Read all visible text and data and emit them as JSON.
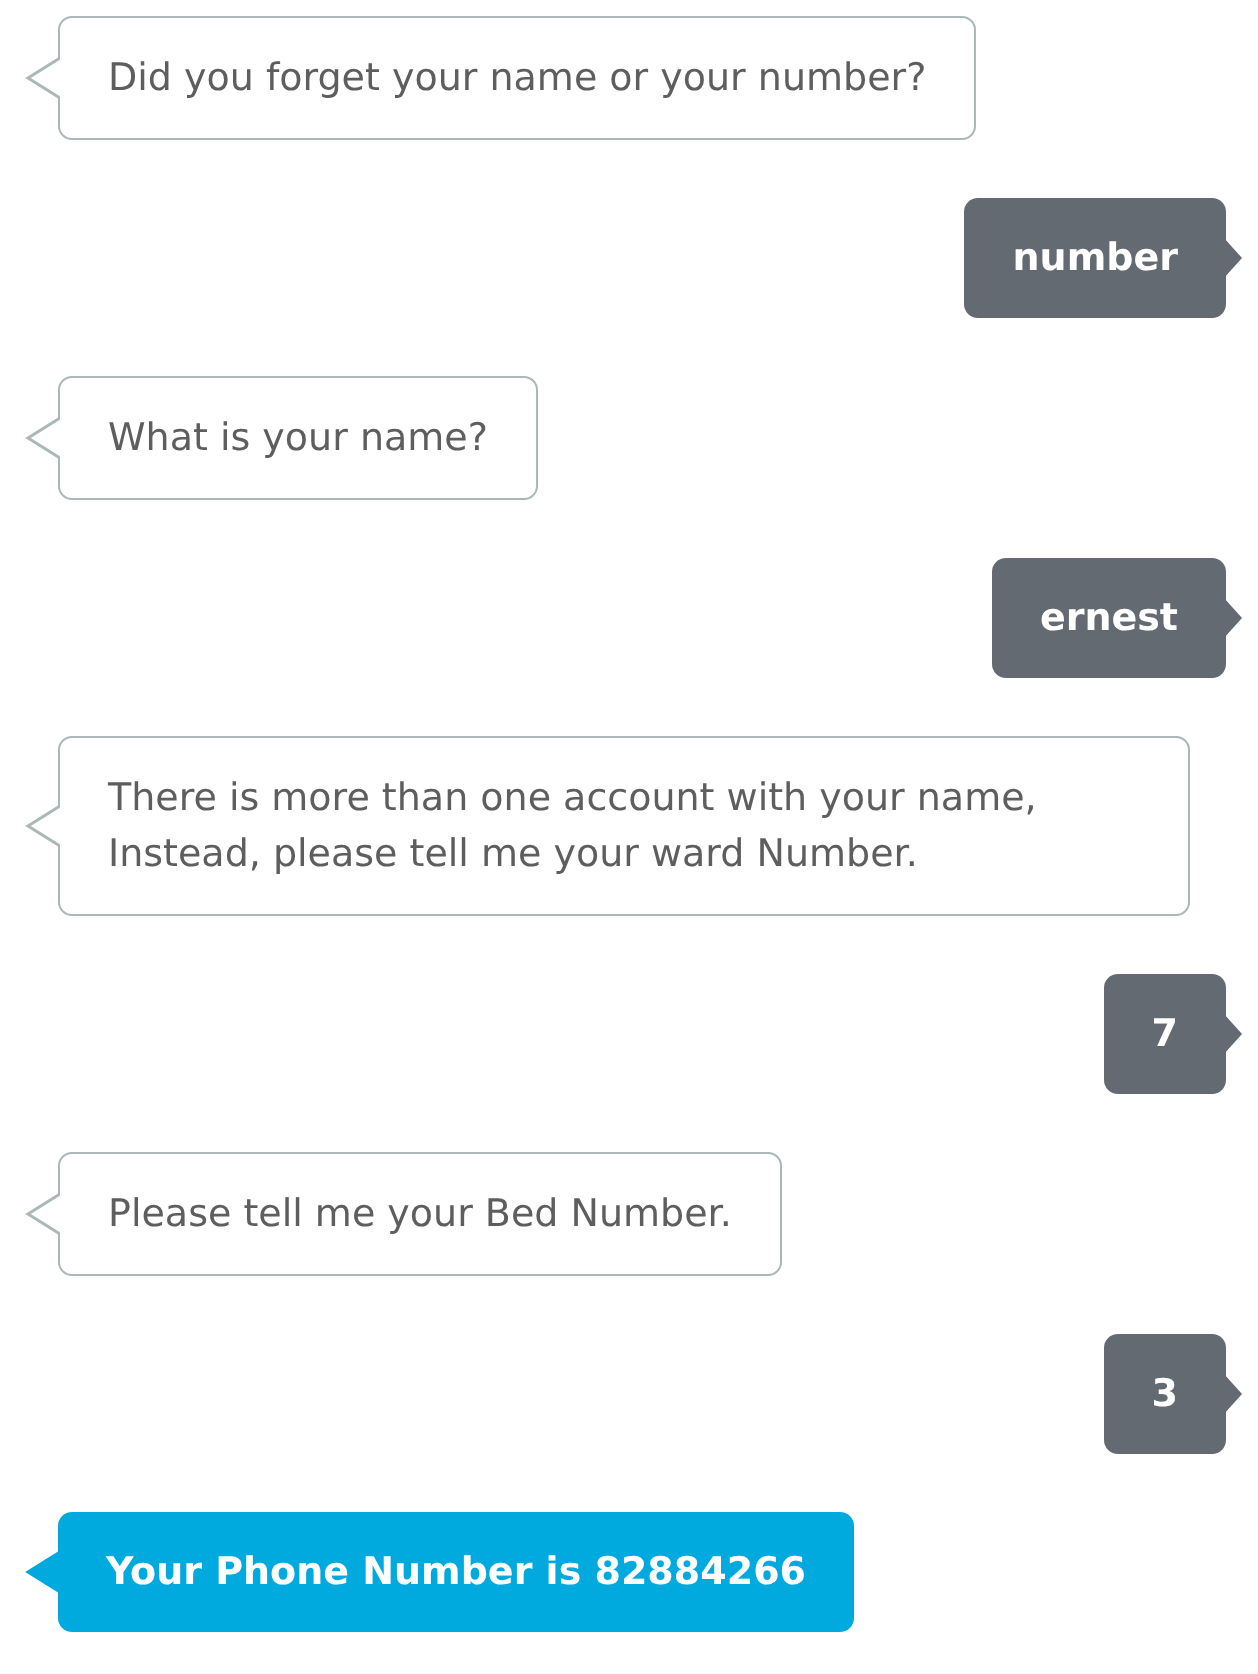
{
  "messages": [
    {
      "kind": "bot",
      "text": "Did you forget your name or your number?"
    },
    {
      "kind": "user",
      "text": "number"
    },
    {
      "kind": "bot",
      "text": "What is your name?"
    },
    {
      "kind": "user",
      "text": "ernest"
    },
    {
      "kind": "bot",
      "text": "There is more than one account with your name, Instead, please tell me your ward Number."
    },
    {
      "kind": "user",
      "text": "7"
    },
    {
      "kind": "bot",
      "text": "Please tell me your Bed Number."
    },
    {
      "kind": "user",
      "text": "3"
    },
    {
      "kind": "result",
      "text": "Your Phone Number is 82884266"
    }
  ]
}
